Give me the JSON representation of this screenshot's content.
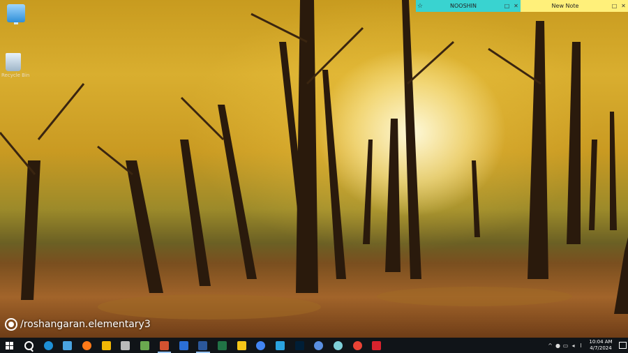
{
  "sticky_notes": [
    {
      "title": "NOOSHIN",
      "color": "#39d3d0"
    },
    {
      "title": "New Note",
      "color": "#fff07a"
    }
  ],
  "desktop": {
    "icons": [
      "this-pc-icon",
      "recycle-bin-icon"
    ],
    "recycle_bin_label": "Recycle Bin"
  },
  "watermark": {
    "text": "/roshangaran.elementary3"
  },
  "taskbar": {
    "apps": [
      {
        "name": "edge",
        "color": "#1e90d6"
      },
      {
        "name": "control-panel",
        "color": "#4aa3df"
      },
      {
        "name": "firefox",
        "color": "#ff7a18"
      },
      {
        "name": "file-explorer-yellow",
        "color": "#f2b705"
      },
      {
        "name": "media-player",
        "color": "#b9b9b9"
      },
      {
        "name": "app-tools",
        "color": "#6aa84f"
      },
      {
        "name": "powerpoint",
        "color": "#d35230",
        "active": true
      },
      {
        "name": "settings-app",
        "color": "#2b6fd6"
      },
      {
        "name": "word",
        "color": "#2b579a",
        "active": true
      },
      {
        "name": "excel",
        "color": "#217346"
      },
      {
        "name": "file-explorer",
        "color": "#f5c518"
      },
      {
        "name": "chrome",
        "color": "#4285f4"
      },
      {
        "name": "telegram",
        "color": "#2aa3e0"
      },
      {
        "name": "photoshop",
        "color": "#001e36"
      },
      {
        "name": "globe-app",
        "color": "#5a8fe0"
      },
      {
        "name": "sphere-app",
        "color": "#7fd0d8"
      },
      {
        "name": "chrome-2",
        "color": "#ea4335"
      },
      {
        "name": "acrobat",
        "color": "#d9232d"
      }
    ],
    "clock": {
      "time": "10:04 AM",
      "date": "4/7/2024"
    }
  }
}
